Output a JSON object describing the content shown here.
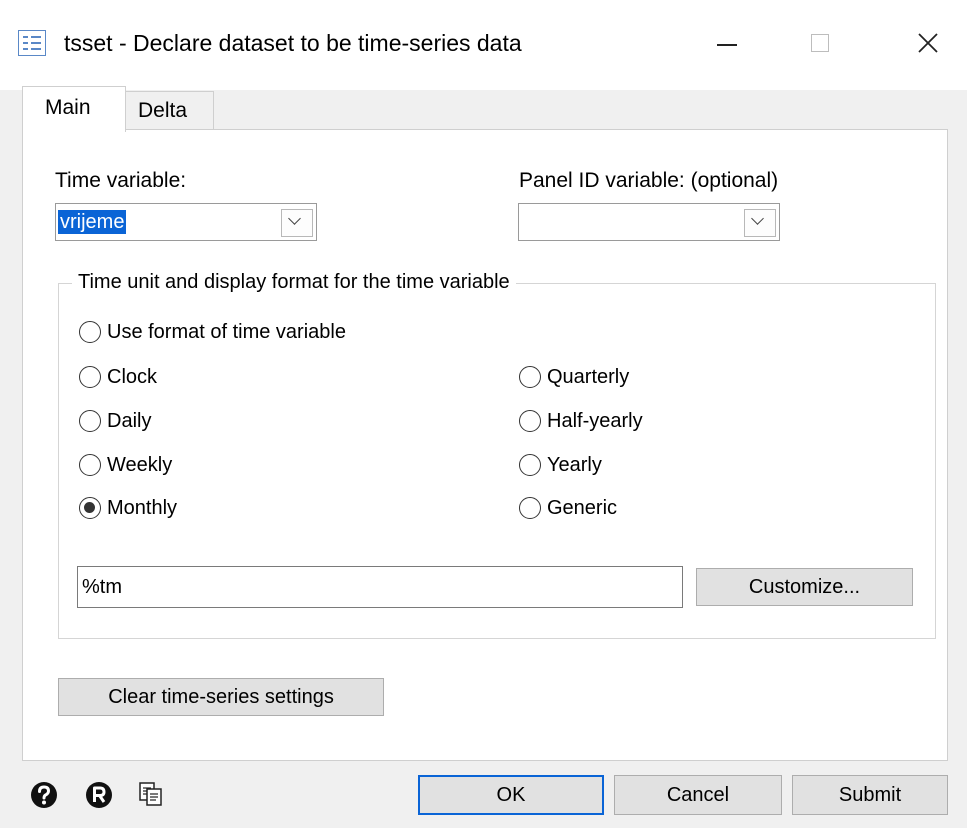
{
  "window": {
    "title": "tsset - Declare dataset to be time-series data"
  },
  "tabs": [
    {
      "label": "Main",
      "selected": true
    },
    {
      "label": "Delta",
      "selected": false
    }
  ],
  "main": {
    "time_variable": {
      "label": "Time variable:",
      "value": "vrijeme"
    },
    "panel_id_variable": {
      "label": "Panel ID variable:  (optional)",
      "value": ""
    },
    "time_unit_group": {
      "legend": "Time unit and display format for the time variable",
      "options": {
        "use_format": "Use format of time variable",
        "clock": "Clock",
        "daily": "Daily",
        "weekly": "Weekly",
        "monthly": "Monthly",
        "quarterly": "Quarterly",
        "half_yearly": "Half-yearly",
        "yearly": "Yearly",
        "generic": "Generic"
      },
      "selected": "monthly",
      "format_value": "%tm",
      "customize_label": "Customize..."
    },
    "clear_label": "Clear time-series settings"
  },
  "footer": {
    "icons": [
      "help-icon",
      "reset-icon",
      "copy-command-icon"
    ],
    "ok_label": "OK",
    "cancel_label": "Cancel",
    "submit_label": "Submit"
  },
  "colors": {
    "selection": "#0a64d6",
    "window_bg": "#f0f0f0",
    "panel_bg": "#ffffff"
  }
}
